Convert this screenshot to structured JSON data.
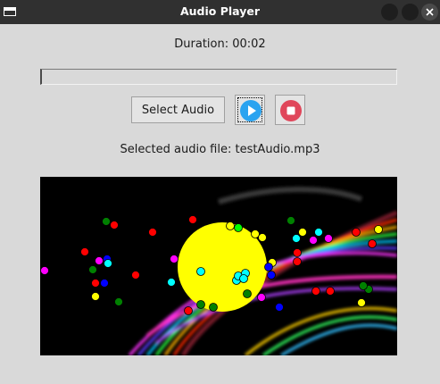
{
  "window": {
    "title": "Audio Player",
    "icon": "window-icon",
    "controls": [
      "minimize-icon",
      "maximize-icon",
      "close-icon"
    ]
  },
  "player": {
    "duration_text": "Duration: 00:02",
    "progress": 0,
    "select_label": "Select Audio",
    "play_icon": "play-icon",
    "stop_icon": "stop-icon",
    "selected_file_text": "Selected audio file: testAudio.mp3"
  },
  "colors": {
    "window_bg": "#d9d9d9",
    "titlebar": "#303030",
    "play_blue": "#2aa3f0",
    "stop_red": "#e0465a",
    "sun_yellow": "#ffff00"
  },
  "visualizer": {
    "background": "#000000",
    "dot_palette": [
      "#ff0000",
      "#00ff00",
      "#0000ff",
      "#ffff00",
      "#00ffff",
      "#ff00ff",
      "#008000"
    ]
  }
}
